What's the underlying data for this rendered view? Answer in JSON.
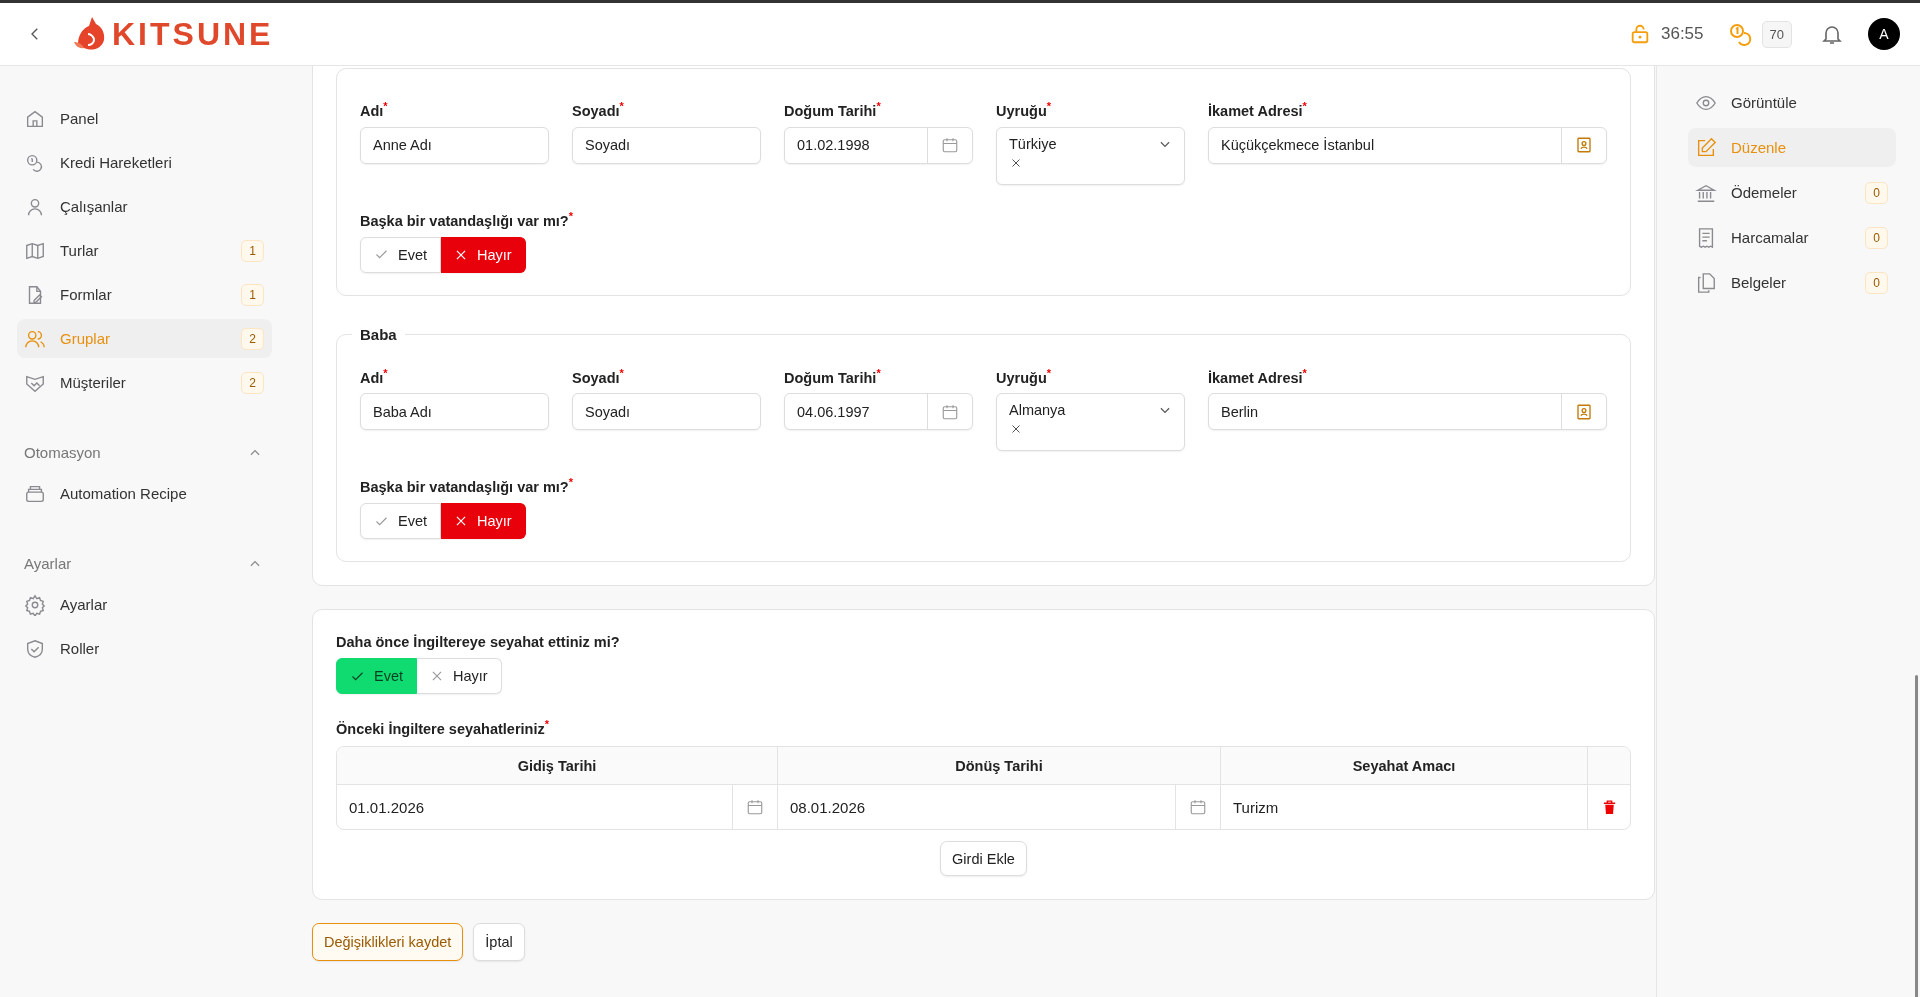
{
  "header": {
    "logo": "KITSUNE",
    "timer": "36:55",
    "credits": "70",
    "avatar": "A"
  },
  "sidebar": {
    "items": [
      {
        "label": "Panel",
        "selected": false
      },
      {
        "label": "Kredi Hareketleri",
        "selected": false
      },
      {
        "label": "Çalışanlar",
        "selected": false
      },
      {
        "label": "Turlar",
        "badge": "1",
        "selected": false
      },
      {
        "label": "Formlar",
        "badge": "1",
        "selected": false
      },
      {
        "label": "Gruplar",
        "badge": "2",
        "selected": true
      },
      {
        "label": "Müşteriler",
        "badge": "2",
        "selected": false
      }
    ],
    "sections": [
      {
        "title": "Otomasyon",
        "expanded": true,
        "items": [
          {
            "label": "Automation Recipe",
            "selected": false
          }
        ]
      },
      {
        "title": "Ayarlar",
        "expanded": true,
        "items": [
          {
            "label": "Ayarlar",
            "selected": false
          },
          {
            "label": "Roller",
            "selected": false
          }
        ]
      }
    ]
  },
  "parents": [
    {
      "fields": [
        {
          "label": "Adı$^{*}$",
          "kind": "text",
          "value": "Anne Adı"
        },
        {
          "label": "Soyadı$^{*}$",
          "kind": "text",
          "value": "Soyadı"
        },
        {
          "label": "Doğum Tarihi$^{*}$",
          "kind": "date",
          "value": "01.02.1998"
        },
        {
          "label": "Uyruğu$^{*}$",
          "kind": "select",
          "value": "Türkiye"
        },
        {
          "label": "İkamet Adresi$^{*}$",
          "kind": "address",
          "value": "Küçükçekmece İstanbul"
        }
      ],
      "question": {
        "label": "Başka bir vatandaşlığı var mı?$^{*}$",
        "options": [
          {
            "label": "Evet",
            "kind": "yes",
            "selected": false
          },
          {
            "label": "Hayır",
            "kind": "no",
            "selected": true
          }
        ]
      }
    },
    {
      "legend": "Baba",
      "fields": [
        {
          "label": "Adı$^{*}$",
          "kind": "text",
          "value": "Baba Adı"
        },
        {
          "label": "Soyadı$^{*}$",
          "kind": "text",
          "value": "Soyadı"
        },
        {
          "label": "Doğum Tarihi$^{*}$",
          "kind": "date",
          "value": "04.06.1997"
        },
        {
          "label": "Uyruğu$^{*}$",
          "kind": "select",
          "value": "Almanya"
        },
        {
          "label": "İkamet Adresi$^{*}$",
          "kind": "address",
          "value": "Berlin"
        }
      ],
      "question": {
        "label": "Başka bir vatandaşlığı var mı?$^{*}$",
        "options": [
          {
            "label": "Evet",
            "kind": "yes",
            "selected": false
          },
          {
            "label": "Hayır",
            "kind": "no",
            "selected": true
          }
        ]
      }
    }
  ],
  "travel": {
    "question": {
      "label": "Daha önce İngiltereye seyahat ettiniz mi?",
      "options": [
        {
          "label": "Evet",
          "kind": "yes",
          "selected": true
        },
        {
          "label": "Hayır",
          "kind": "no",
          "selected": false
        }
      ]
    },
    "table_label": "Önceki İngiltere seyahatleriniz$^{*}$",
    "table": {
      "columns": [
        "Gidiş Tarihi",
        "Dönüş Tarihi",
        "Seyahat Amacı"
      ],
      "rows": [
        [
          {
            "kind": "date",
            "value": "01.01.2026"
          },
          {
            "kind": "date",
            "value": "08.01.2026"
          },
          {
            "kind": "text",
            "value": "Turizm"
          }
        ]
      ]
    },
    "add_button": "Girdi Ekle"
  },
  "actions": [
    {
      "label": "Değişiklikleri kaydet",
      "kind": "primary"
    },
    {
      "label": "İptal",
      "kind": "secondary"
    }
  ],
  "right_panel": {
    "items": [
      {
        "label": "Görüntüle",
        "selected": false
      },
      {
        "label": "Düzenle",
        "selected": true
      },
      {
        "label": "Ödemeler",
        "badge": "0",
        "selected": false
      },
      {
        "label": "Harcamalar",
        "badge": "0",
        "selected": false
      },
      {
        "label": "Belgeler",
        "badge": "0",
        "selected": false
      }
    ]
  }
}
